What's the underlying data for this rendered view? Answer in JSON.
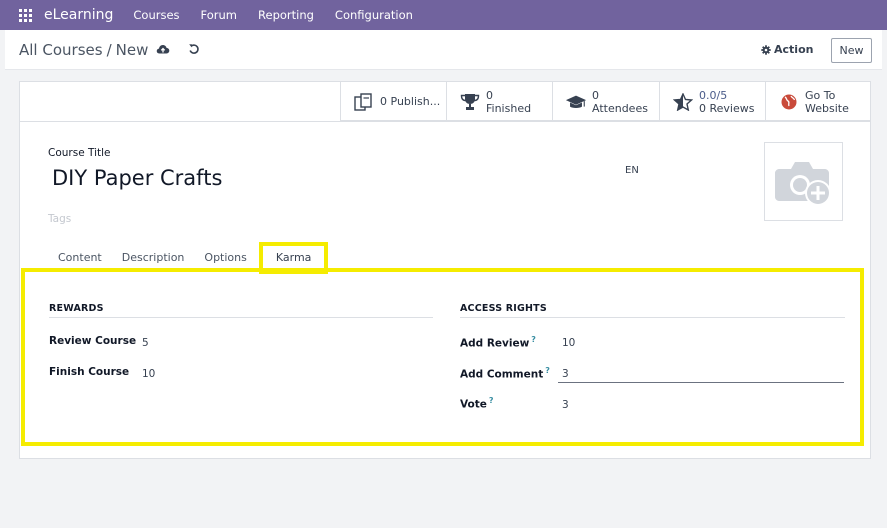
{
  "navbar": {
    "brand": "eLearning",
    "menu": [
      "Courses",
      "Forum",
      "Reporting",
      "Configuration"
    ],
    "bg_color": "#71639e"
  },
  "control": {
    "breadcrumb_parent": "All Courses",
    "breadcrumb_sep": "/",
    "breadcrumb_current": "New",
    "action_label": "Action",
    "new_label": "New"
  },
  "stats": [
    {
      "icon": "copy-icon",
      "value": "0",
      "label": "Publish..."
    },
    {
      "icon": "trophy-icon",
      "value": "0",
      "label": "Finished"
    },
    {
      "icon": "graduation-cap-icon",
      "value": "0",
      "label": "Attendees"
    },
    {
      "icon": "star-half-icon",
      "value": "0.0/5",
      "label": "0 Reviews"
    },
    {
      "icon": "globe-icon",
      "value": "Go To",
      "label": "Website"
    }
  ],
  "form": {
    "course_title_label": "Course Title",
    "course_title": "DIY Paper Crafts",
    "lang": "EN",
    "tags_placeholder": "Tags"
  },
  "tabs": [
    "Content",
    "Description",
    "Options",
    "Karma"
  ],
  "active_tab": "Karma",
  "karma": {
    "rewards_title": "REWARDS",
    "rewards": [
      {
        "label": "Review Course",
        "value": "5"
      },
      {
        "label": "Finish Course",
        "value": "10"
      }
    ],
    "access_title": "ACCESS RIGHTS",
    "access": [
      {
        "label": "Add Review",
        "help": "?",
        "value": "10"
      },
      {
        "label": "Add Comment",
        "help": "?",
        "value": "3"
      },
      {
        "label": "Vote",
        "help": "?",
        "value": "3"
      }
    ]
  },
  "highlight_color": "#f5ec00"
}
